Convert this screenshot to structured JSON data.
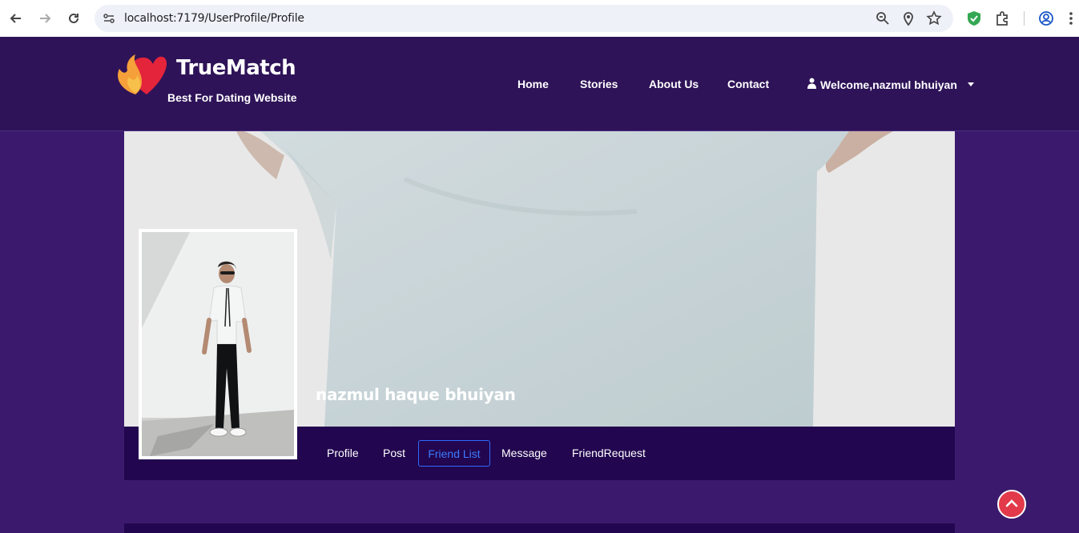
{
  "browser": {
    "url": "localhost:7179/UserProfile/Profile"
  },
  "header": {
    "brand_name": "TrueMatch",
    "brand_tagline": "Best For Dating Website",
    "nav": [
      "Home",
      "Stories",
      "About Us",
      "Contact"
    ],
    "welcome": "Welcome,nazmul bhuiyan"
  },
  "profile": {
    "name": "nazmul haque bhuiyan",
    "tabs": [
      "Profile",
      "Post",
      "Friend List",
      "Message",
      "FriendRequest"
    ],
    "active_tab": "Friend List"
  },
  "colors": {
    "header_bg": "#2e1358",
    "page_bg": "#3b1a6e",
    "bar_bg": "#22064f",
    "active_tab": "#3d7bff",
    "scroll_top": "#e23a4a"
  }
}
